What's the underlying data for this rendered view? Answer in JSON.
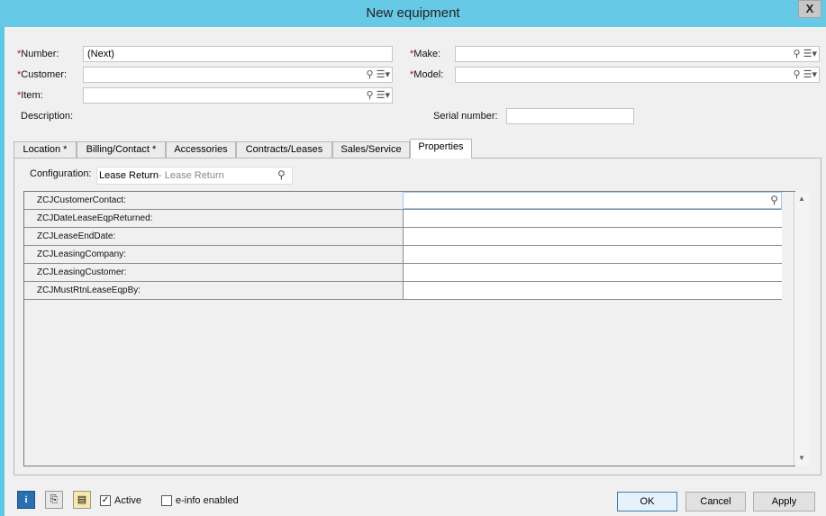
{
  "window": {
    "title": "New equipment",
    "close_label": "X"
  },
  "form": {
    "required_mark": "*",
    "number_label": "Number:",
    "number_value": "(Next)",
    "customer_label": "Customer:",
    "customer_value": "",
    "item_label": "Item:",
    "item_value": "",
    "description_label": "Description:",
    "make_label": "Make:",
    "make_value": "",
    "model_label": "Model:",
    "model_value": "",
    "serial_label": "Serial number:",
    "serial_value": ""
  },
  "tabs": [
    {
      "label": "Location *"
    },
    {
      "label": "Billing/Contact *"
    },
    {
      "label": "Accessories"
    },
    {
      "label": "Contracts/Leases"
    },
    {
      "label": "Sales/Service"
    },
    {
      "label": "Properties",
      "active": true
    }
  ],
  "properties": {
    "configuration_label": "Configuration:",
    "configuration_value": "Lease Return",
    "configuration_desc": "- Lease Return",
    "rows": [
      {
        "name": "ZCJCustomerContact:",
        "value": ""
      },
      {
        "name": "ZCJDateLeaseEqpReturned:",
        "value": ""
      },
      {
        "name": "ZCJLeaseEndDate:",
        "value": ""
      },
      {
        "name": "ZCJLeasingCompany:",
        "value": ""
      },
      {
        "name": "ZCJLeasingCustomer:",
        "value": ""
      },
      {
        "name": "ZCJMustRtnLeaseEqpBy:",
        "value": ""
      }
    ]
  },
  "footer": {
    "active_label": "Active",
    "active_checked": true,
    "einfo_label": "e-info enabled",
    "einfo_checked": false,
    "ok_label": "OK",
    "cancel_label": "Cancel",
    "apply_label": "Apply"
  },
  "icons": {
    "lookup": "magnifier-icon",
    "dropdown": "dropdown-menu-icon",
    "info": "info-icon",
    "attach": "paperclip-icon",
    "note": "note-icon",
    "checkmark": "✓"
  }
}
